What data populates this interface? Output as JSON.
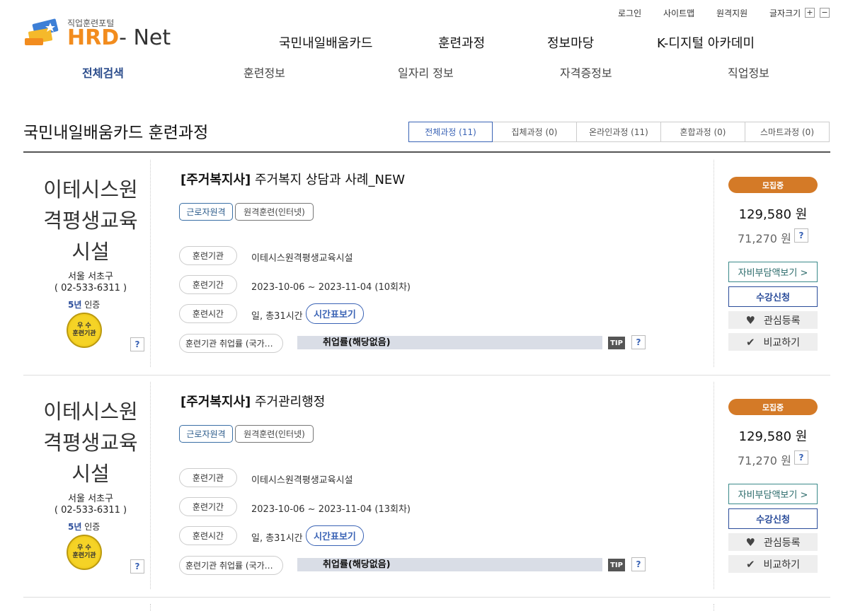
{
  "header": {
    "logo_sub": "직업훈련포털",
    "logo_main_a": "HRD",
    "logo_main_b": "- Net",
    "util": {
      "login": "로그인",
      "sitemap": "사이트맵",
      "remote": "원격지원",
      "font_size": "글자크기",
      "plus": "+",
      "minus": "−"
    },
    "gnb": [
      "국민내일배움카드",
      "훈련과정",
      "정보마당",
      "K-디지털 아카데미"
    ],
    "sub": [
      "전체검색",
      "훈련정보",
      "일자리 정보",
      "자격증정보",
      "직업정보"
    ]
  },
  "page": {
    "title": "국민내일배움카드 훈련과정",
    "tabs": [
      "전체과정 (11)",
      "집체과정 (0)",
      "온라인과정 (11)",
      "혼합과정 (0)",
      "스마트과정 (0)"
    ]
  },
  "labels": {
    "inst": "훈련기관",
    "period": "훈련기간",
    "hours": "훈련시간",
    "employ": "훈련기관 취업률 (국가…",
    "timetable": "시간표보기",
    "tip": "TIP",
    "q": "?",
    "cert_years": "5년",
    "cert_suffix": " 인증",
    "seal_top": "우 수",
    "seal_bottom": "훈련기관",
    "self_pay": "자비부담액보기 >",
    "apply": "수강신청",
    "favorite": "관심등록",
    "compare": "비교하기",
    "won": " 원"
  },
  "courses": [
    {
      "inst_lines": [
        "이테시스원",
        "격평생교육",
        "시설"
      ],
      "region": "서울 서초구",
      "phone": "( 02-533-6311 )",
      "category": "[주거복지사]",
      "name": " 주거복지 상담과 사례_NEW",
      "tags": [
        "근로자원격",
        "원격훈련(인터넷)"
      ],
      "inst": "이테시스원격평생교육시설",
      "period": "2023-10-06 ~ 2023-11-04 (10회차)",
      "hours": "일, 총31시간",
      "employ_value": "취업률(해당없음)",
      "status": "모집중",
      "price": "129,580",
      "price_self": "71,270"
    },
    {
      "inst_lines": [
        "이테시스원",
        "격평생교육",
        "시설"
      ],
      "region": "서울 서초구",
      "phone": "( 02-533-6311 )",
      "category": "[주거복지사]",
      "name": " 주거관리행정",
      "tags": [
        "근로자원격",
        "원격훈련(인터넷)"
      ],
      "inst": "이테시스원격평생교육시설",
      "period": "2023-10-06 ~ 2023-11-04 (13회차)",
      "hours": "일, 총31시간",
      "employ_value": "취업률(해당없음)",
      "status": "모집중",
      "price": "129,580",
      "price_self": "71,270"
    }
  ],
  "colors": {
    "accent": "#3a63b5",
    "status": "#d47a27",
    "logo_orange": "#f28c1e"
  }
}
